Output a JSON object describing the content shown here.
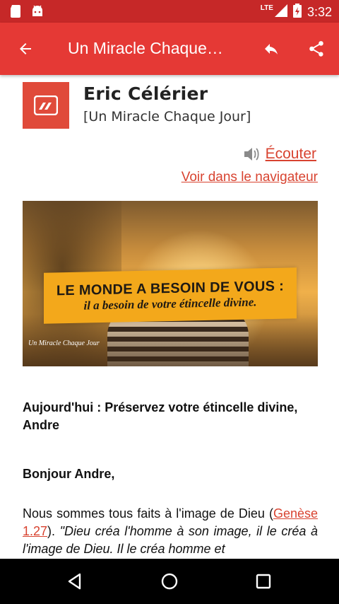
{
  "status": {
    "network_label": "LTE",
    "time": "3:32",
    "icons": [
      "sd-card-icon",
      "android-icon",
      "signal-icon",
      "battery-charging-icon"
    ]
  },
  "app_bar": {
    "title": "Un Miracle Chaque…",
    "icons": [
      "arrow-back-icon",
      "reply-icon",
      "share-icon"
    ]
  },
  "header": {
    "author": "Eric Célérier",
    "newsletter": "[Un Miracle Chaque Jour]",
    "listen_label": "Écouter",
    "browser_label": "Voir dans le navigateur"
  },
  "hero": {
    "line1": "LE MONDE A BESOIN DE VOUS :",
    "line2": "il a besoin de votre étincelle divine.",
    "brand": "Un Miracle Chaque Jour"
  },
  "body": {
    "subject": "Aujourd'hui : Préservez votre étincelle divine, Andre",
    "greeting": "Bonjour Andre,",
    "text_before": "Nous sommes tous faits à l'image de Dieu (",
    "reference": "Genèse 1.27",
    "text_after": "). ",
    "quote": "\"Dieu créa l'homme à son image, il le créa à l'image de Dieu. Il le créa homme et"
  },
  "colors": {
    "status_bar": "#c62828",
    "app_bar": "#e53935",
    "link": "#d84330",
    "banner": "#f3a81b"
  }
}
